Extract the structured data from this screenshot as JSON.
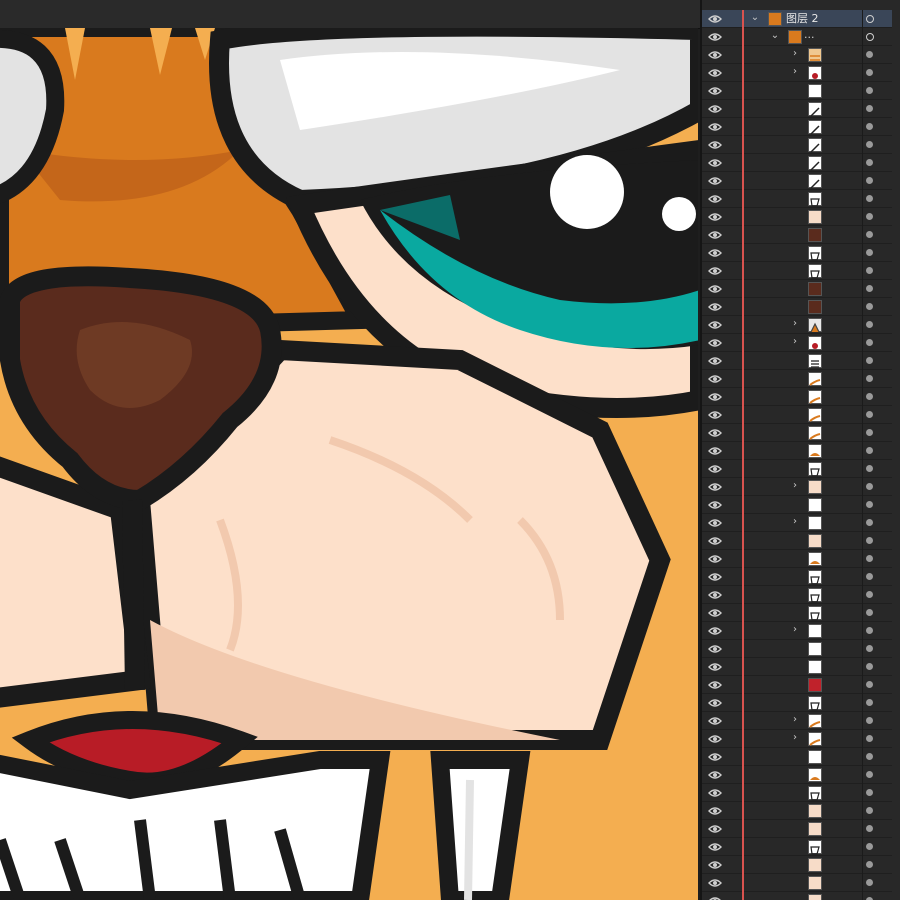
{
  "layers_panel": {
    "top_layer": {
      "name": "图层 2",
      "visible": true,
      "expanded": true
    },
    "group": {
      "name": "...",
      "expanded": true
    },
    "rows": [
      {
        "thumb": "stripes",
        "chevron": true
      },
      {
        "thumb": "red-shape",
        "chevron": true
      },
      {
        "thumb": "white"
      },
      {
        "thumb": "line"
      },
      {
        "thumb": "line"
      },
      {
        "thumb": "line"
      },
      {
        "thumb": "line"
      },
      {
        "thumb": "line"
      },
      {
        "thumb": "outline"
      },
      {
        "thumb": "peach"
      },
      {
        "thumb": "brown"
      },
      {
        "thumb": "outline"
      },
      {
        "thumb": "outline"
      },
      {
        "thumb": "brown"
      },
      {
        "thumb": "brown"
      },
      {
        "thumb": "mixed",
        "chevron": true
      },
      {
        "thumb": "red-shape",
        "chevron": true
      },
      {
        "thumb": "grid"
      },
      {
        "thumb": "orange-line"
      },
      {
        "thumb": "orange-line"
      },
      {
        "thumb": "orange-line"
      },
      {
        "thumb": "orange-line"
      },
      {
        "thumb": "orange"
      },
      {
        "thumb": "outline"
      },
      {
        "thumb": "peach",
        "chevron": true
      },
      {
        "thumb": "white"
      },
      {
        "thumb": "white",
        "chevron": true
      },
      {
        "thumb": "peach"
      },
      {
        "thumb": "orange"
      },
      {
        "thumb": "outline"
      },
      {
        "thumb": "outline"
      },
      {
        "thumb": "outline"
      },
      {
        "thumb": "white",
        "chevron": true
      },
      {
        "thumb": "white"
      },
      {
        "thumb": "white"
      },
      {
        "thumb": "red"
      },
      {
        "thumb": "outline"
      },
      {
        "thumb": "orange-line",
        "chevron": true
      },
      {
        "thumb": "orange-line",
        "chevron": true
      },
      {
        "thumb": "white"
      },
      {
        "thumb": "orange"
      },
      {
        "thumb": "outline"
      },
      {
        "thumb": "peach"
      },
      {
        "thumb": "peach"
      },
      {
        "thumb": "outline"
      },
      {
        "thumb": "peach"
      },
      {
        "thumb": "peach"
      },
      {
        "thumb": "peach"
      }
    ]
  },
  "colors": {
    "background": "#f4ae50",
    "fur_orange": "#d97a1e",
    "outline": "#1b1b1b",
    "nose": "#5a2b1d",
    "muzzle": "#fde0ca",
    "eye_teal": "#0aa9a0",
    "tongue": "#b81c26",
    "teeth": "#ffffff"
  }
}
